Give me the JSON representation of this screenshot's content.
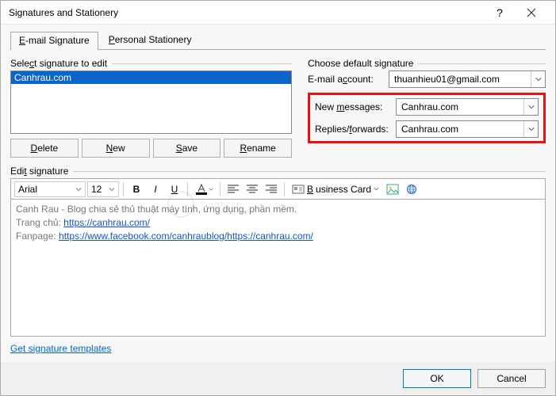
{
  "titlebar": {
    "title": "Signatures and Stationery"
  },
  "tabs": {
    "email": "E-mail Signature",
    "stationery": "Personal Stationery",
    "email_u": "E",
    "stationery_u": "P"
  },
  "leftgroup": {
    "label": "Select signature to edit",
    "item": "Canhrau.com",
    "buttons": {
      "delete": "Delete",
      "new": "New",
      "save": "Save",
      "rename": "Rename",
      "delete_u": "D",
      "new_u": "N",
      "save_u": "S",
      "rename_u": "R"
    }
  },
  "rightgroup": {
    "label": "Choose default signature",
    "account_lbl": "E-mail account:",
    "account_u": "c",
    "account_val": "thuanhieu01@gmail.com",
    "new_lbl": "New messages:",
    "new_u": "m",
    "new_val": "Canhrau.com",
    "rep_lbl": "Replies/forwards:",
    "rep_u": "f",
    "rep_val": "Canhrau.com"
  },
  "editgroup": {
    "label": "Edit signature",
    "font": "Arial",
    "size": "12",
    "bizcard": "Business Card",
    "text_line1": "Canh Rau - Blog chia sẻ thủ thuật máy tính, ứng dụng, phần mềm.",
    "text_line2_label": "Trang chủ: ",
    "text_line2_link": "https://canhrau.com/",
    "text_line3_label": "Fanpage: ",
    "text_line3_link1": "https://www.facebook.com/canhraublog/",
    "text_line3_link2": "https://canhrau.com/"
  },
  "footerlink": "Get signature templates",
  "footer": {
    "ok": "OK",
    "cancel": "Cancel"
  },
  "watermark": "Canhrau"
}
